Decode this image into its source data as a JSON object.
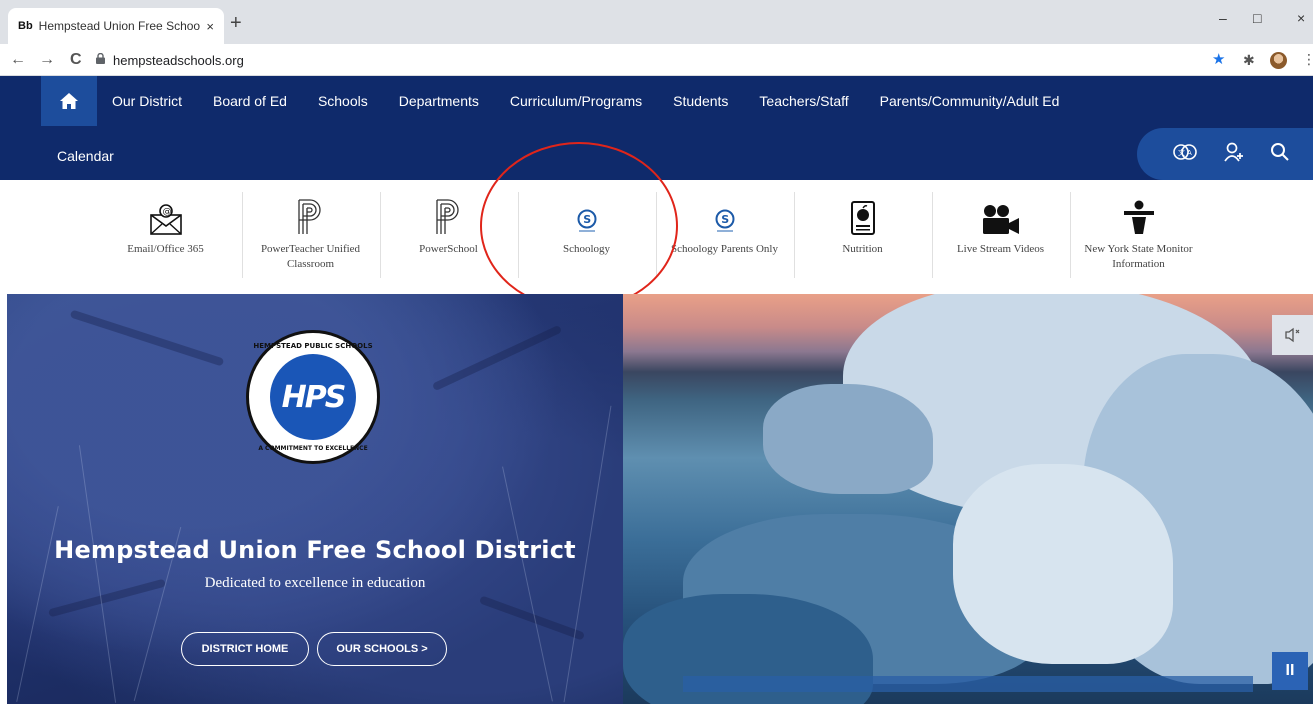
{
  "browser": {
    "tab": {
      "favicon": "Bb",
      "title": "Hempstead Union Free School D",
      "close": "×"
    },
    "newtab": "+",
    "window": {
      "minimize": "–",
      "maximize": "□",
      "close": "×"
    },
    "nav": {
      "back": "←",
      "forward": "→",
      "reload": "C"
    },
    "url": "hempsteadschools.org",
    "icons": [
      "lock-icon",
      "bookmark-star-icon",
      "extensions-icon",
      "profile-avatar",
      "menu-icon"
    ]
  },
  "site": {
    "nav": {
      "items": [
        "Our District",
        "Board of Ed",
        "Schools",
        "Departments",
        "Curriculum/Programs",
        "Students",
        "Teachers/Staff",
        "Parents/Community/Adult Ed"
      ],
      "calendar": "Calendar"
    },
    "utility_icons": [
      "translate-icon",
      "user-sign-in-icon",
      "search-icon"
    ],
    "quicklinks": [
      {
        "label": "Email/Office 365",
        "icon": "email-icon"
      },
      {
        "label": "PowerTeacher Unified Classroom",
        "icon": "powerschool-icon"
      },
      {
        "label": "PowerSchool",
        "icon": "powerschool-icon"
      },
      {
        "label": "Schoology",
        "icon": "schoology-icon"
      },
      {
        "label": "Schoology Parents Only",
        "icon": "schoology-icon"
      },
      {
        "label": "Nutrition",
        "icon": "nutrition-icon"
      },
      {
        "label": "Live Stream Videos",
        "icon": "video-camera-icon"
      },
      {
        "label": "New York State Monitor Information",
        "icon": "monitor-person-icon"
      }
    ],
    "hero": {
      "logo": {
        "top": "HEMPSTEAD PUBLIC SCHOOLS",
        "center": "HPS",
        "bottom": "A COMMITMENT TO EXCELLENCE"
      },
      "title": "Hempstead Union Free School District",
      "subtitle": "Dedicated to excellence in education",
      "buttons": {
        "district_home": "DISTRICT HOME",
        "our_schools": "OUR SCHOOLS >"
      }
    },
    "video": {
      "pause": "II",
      "mute": "mute-icon"
    },
    "colors": {
      "header": "#0f2a6b",
      "accent": "#1d4d9c",
      "annotation": "#e0251a"
    }
  }
}
